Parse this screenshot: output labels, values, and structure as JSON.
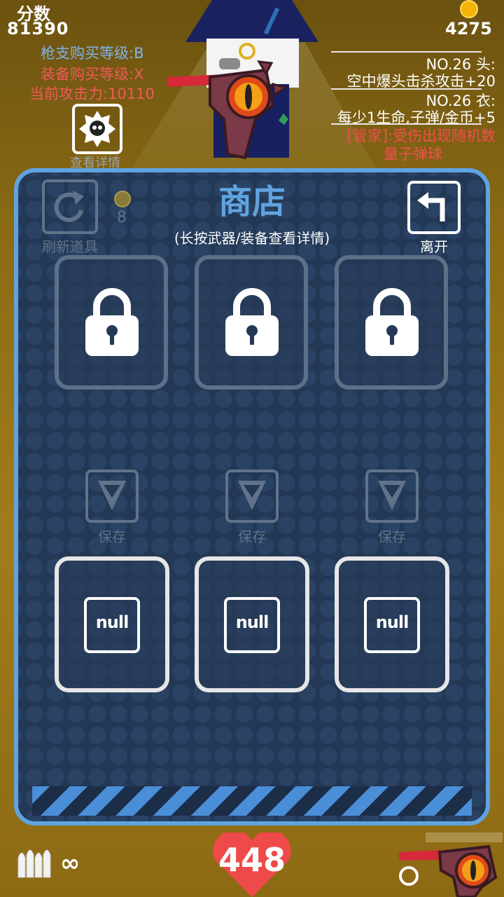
{
  "hud": {
    "score_label": "分数",
    "score_value": "81390",
    "gun_purchase_grade": "枪支购买等级:B",
    "equip_purchase_grade": "装备购买等级:X",
    "current_attack": "当前攻击力:10110",
    "detail_label": "查看详情",
    "coins": "4275"
  },
  "equipment_info": {
    "head_title": "NO.26 头:",
    "head_effect": "空中爆头击杀攻击+20",
    "body_title": "NO.26 衣:",
    "body_effect": "每少1生命,子弹/金币+5",
    "butler_line1": "[管家]:受伤出现随机数",
    "butler_line2": "量子弹球"
  },
  "shop": {
    "title": "商店",
    "subtitle": "(长按武器/装备查看详情)",
    "refresh_label": "刷新道具",
    "refresh_cost": "8",
    "leave_label": "离开",
    "locked_slots": [
      {
        "icon": "lock-icon"
      },
      {
        "icon": "lock-icon"
      },
      {
        "icon": "lock-icon"
      }
    ],
    "save_buttons": [
      {
        "label": "保存"
      },
      {
        "label": "保存"
      },
      {
        "label": "保存"
      }
    ],
    "inventory_slots": [
      {
        "label": "null"
      },
      {
        "label": "null"
      },
      {
        "label": "null"
      }
    ]
  },
  "bottom": {
    "hp": "448",
    "ammo": "∞"
  },
  "colors": {
    "panel_border": "#5fa4e0",
    "panel_bg": "#233855",
    "accent_red": "#ef5a5a",
    "accent_blue": "#7fb2e8",
    "heart": "#ef4a4a",
    "coin": "#f3b40a"
  }
}
